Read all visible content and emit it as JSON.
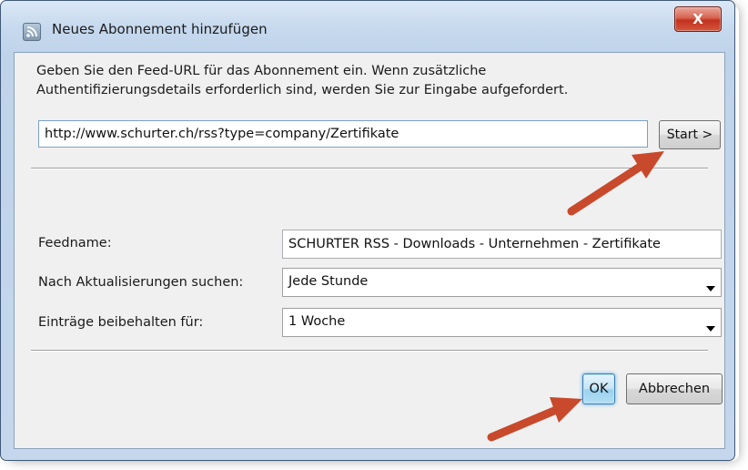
{
  "window": {
    "title": "Neues Abonnement hinzufügen",
    "close_label": "X",
    "icon": "rss-feed-icon"
  },
  "intro": {
    "line1": "Geben Sie den Feed-URL für das Abonnement ein. Wenn zusätzliche",
    "line2": "Authentifizierungsdetails erforderlich sind, werden Sie zur Eingabe aufgefordert."
  },
  "url": {
    "value": "http://www.schurter.ch/rss?type=company/Zertifikate"
  },
  "start_button": "Start >",
  "feedname": {
    "label": "Feedname:",
    "value": "SCHURTER RSS - Downloads - Unternehmen - Zertifikate"
  },
  "update_interval": {
    "label": "Nach Aktualisierungen suchen:",
    "selected": "Jede Stunde"
  },
  "retention": {
    "label": "Einträge beibehalten für:",
    "selected": "1 Woche"
  },
  "buttons": {
    "ok": "OK",
    "cancel": "Abbrechen"
  },
  "colors": {
    "annotation_arrow": "#c8492c",
    "close_button": "#c2321e",
    "default_button_glow": "#5fb2e7"
  }
}
